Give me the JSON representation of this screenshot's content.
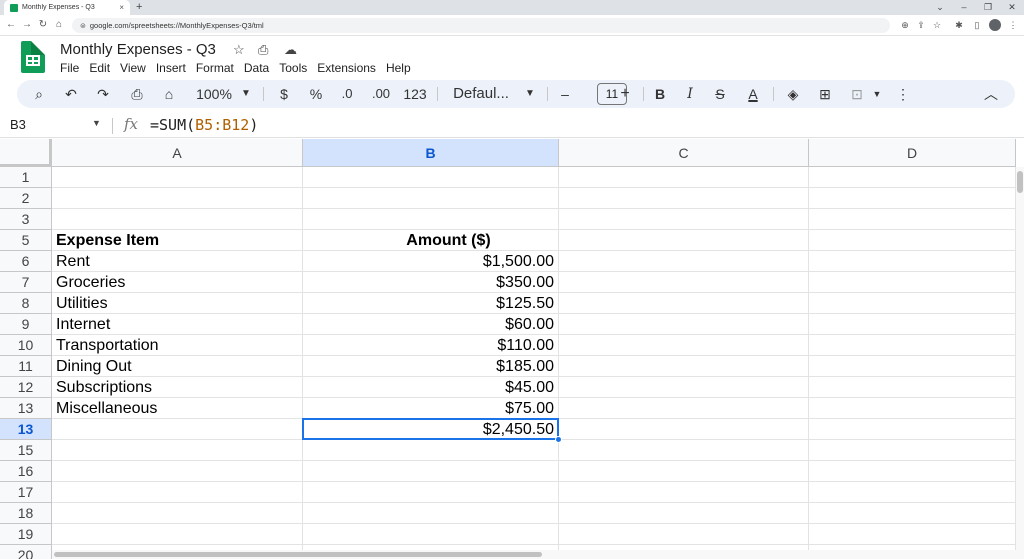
{
  "browser": {
    "tab_title": "Monthly Expenses - Q3",
    "tab_close": "×",
    "new_tab": "+",
    "url": "google.com/spreetsheets://MonthlyExpenses-Q3/tml",
    "window_controls": [
      "⌄",
      "–",
      "❐",
      "✕"
    ]
  },
  "doc": {
    "title": "Monthly Expenses - Q3",
    "menus": [
      "File",
      "Edit",
      "View",
      "Insert",
      "Format",
      "Data",
      "Tools",
      "Extensions",
      "Help"
    ]
  },
  "toolbar": {
    "zoom": "100%",
    "currency": "$",
    "percent": "%",
    "decrease_decimal": ".0",
    "increase_decimal": ".00",
    "format_123": "123",
    "font": "Defaul...",
    "font_size": "11",
    "bold": "B",
    "italic": "I",
    "strikethrough": "S",
    "text_color": "A",
    "minus": "–",
    "plus": "+"
  },
  "formula_bar": {
    "name_box": "B3",
    "fx": "fx",
    "formula_prefix": "=SUM(",
    "formula_range": "B5:B12",
    "formula_suffix": ")"
  },
  "grid": {
    "columns": [
      "A",
      "B",
      "C",
      "D"
    ],
    "selected_column": "B",
    "selected_row_label": "13",
    "rows": [
      {
        "label": "1",
        "a": "",
        "b": ""
      },
      {
        "label": "2",
        "a": "",
        "b": ""
      },
      {
        "label": "3",
        "a": "",
        "b": ""
      },
      {
        "label": "5",
        "a": "Expense Item",
        "b": "Amount ($)"
      },
      {
        "label": "6",
        "a": "Rent",
        "b": "$1,500.00"
      },
      {
        "label": "7",
        "a": "Groceries",
        "b": "$350.00"
      },
      {
        "label": "8",
        "a": "Utilities",
        "b": "$125.50"
      },
      {
        "label": "9",
        "a": "Internet",
        "b": "$60.00"
      },
      {
        "label": "10",
        "a": "Transportation",
        "b": "$110.00"
      },
      {
        "label": "11",
        "a": "Dining Out",
        "b": "$185.00"
      },
      {
        "label": "12",
        "a": "Subscriptions",
        "b": "$45.00"
      },
      {
        "label": "13",
        "a": "Miscellaneous",
        "b": "$75.00"
      },
      {
        "label": "13",
        "a": "",
        "b": "$2,450.50"
      },
      {
        "label": "15",
        "a": "",
        "b": ""
      },
      {
        "label": "16",
        "a": "",
        "b": ""
      },
      {
        "label": "17",
        "a": "",
        "b": ""
      },
      {
        "label": "18",
        "a": "",
        "b": ""
      },
      {
        "label": "19",
        "a": "",
        "b": ""
      },
      {
        "label": "20",
        "a": "",
        "b": ""
      }
    ]
  },
  "colors": {
    "accent": "#1a73e8",
    "toolbar_bg": "#edf2fa",
    "selected_header": "#d3e3fd",
    "brand_green": "#0f9d58"
  }
}
